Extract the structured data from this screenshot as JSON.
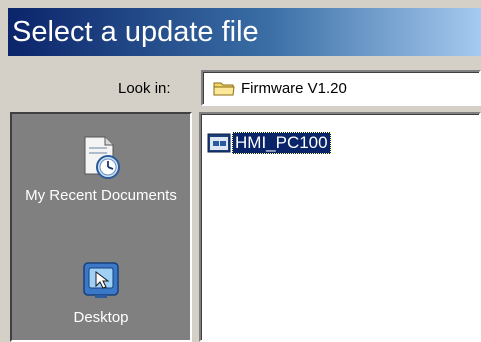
{
  "dialog": {
    "title": "Select a update file"
  },
  "look_in": {
    "label": "Look in:",
    "value": "Firmware V1.20",
    "icon": "folder-icon"
  },
  "places": [
    {
      "label": "My Recent Documents",
      "icon": "recent-documents-icon"
    },
    {
      "label": "Desktop",
      "icon": "desktop-icon"
    }
  ],
  "files": [
    {
      "name": "HMI_PC100",
      "icon": "file-icon",
      "selected": true
    }
  ],
  "colors": {
    "title_start": "#0b246a",
    "title_end": "#a6caf0",
    "selection": "#0a246a",
    "dialog_bg": "#d4d0c8",
    "places_bg": "#808080"
  }
}
